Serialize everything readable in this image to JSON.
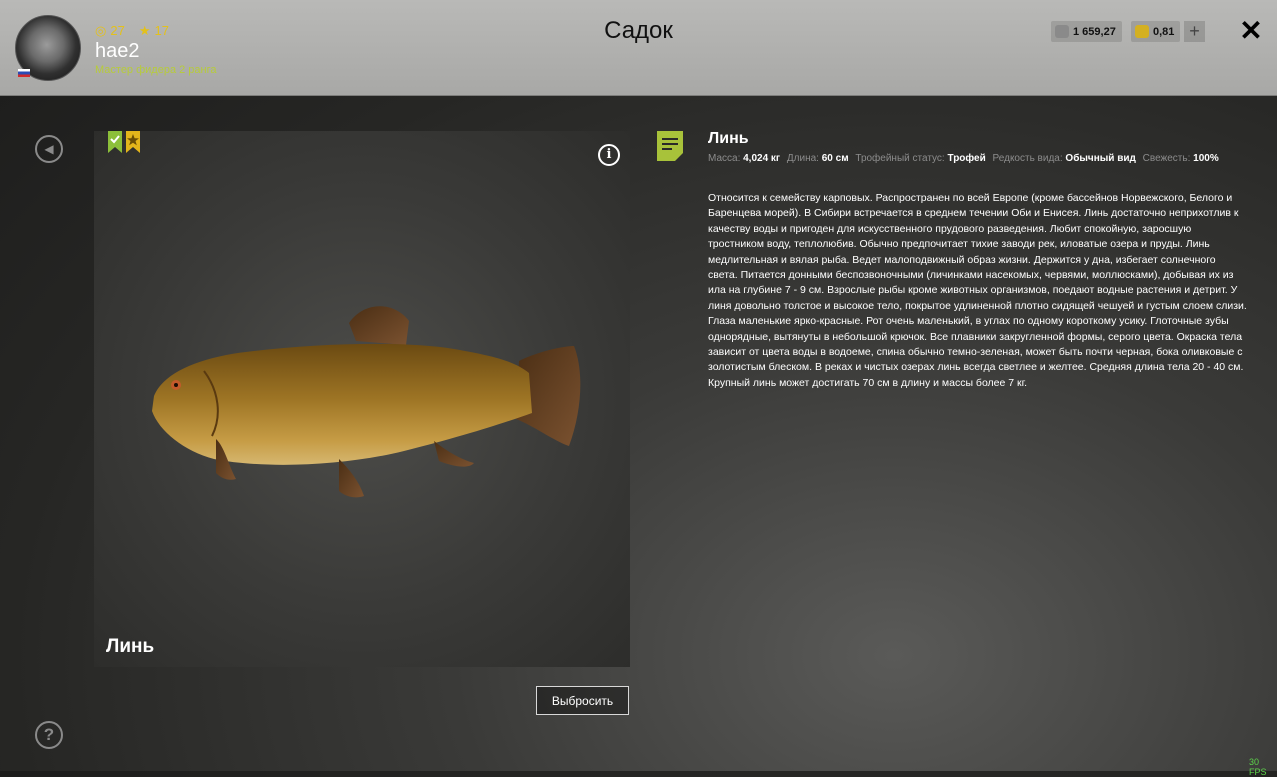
{
  "header": {
    "title": "Садок",
    "coins_count": "27",
    "stars_count": "17",
    "username": "hae2",
    "rank": "Мастер фидера 2 ранга",
    "silver": "1 659,27",
    "gold": "0,81"
  },
  "card": {
    "fish_name": "Линь",
    "throw_label": "Выбросить"
  },
  "details": {
    "name": "Линь",
    "params": [
      {
        "label": "Масса:",
        "value": "4,024 кг"
      },
      {
        "label": "Длина:",
        "value": "60 см"
      },
      {
        "label": "Трофейный статус:",
        "value": "Трофей"
      },
      {
        "label": "Редкость вида:",
        "value": "Обычный вид"
      },
      {
        "label": "Свежесть:",
        "value": "100%"
      }
    ],
    "description": "Относится к семейству карповых. Распространен по всей Европе (кроме бассейнов Норвежского, Белого и Баренцева морей). В Сибири встречается в среднем течении Оби и Енисея. Линь достаточно неприхотлив к качеству воды и пригоден для искусственного прудового разведения. Любит спокойную, заросшую тростником воду, теплолюбив. Обычно предпочитает тихие заводи рек, иловатые озера и пруды. Линь медлительная и вялая рыба. Ведет малоподвижный образ жизни. Держится у дна, избегает солнечного света. Питается донными беспозвоночными (личинками насекомых, червями, моллюсками), добывая их из ила на глубине 7 - 9 см. Взрослые рыбы кроме животных организмов, поедают водные растения и детрит. У линя довольно толстое и высокое тело, покрытое удлиненной плотно сидящей чешуей и густым слоем слизи. Глаза маленькие ярко-красные. Рот очень маленький, в углах по одному короткому усику. Глоточные зубы однорядные, вытянуты в небольшой крючок. Все плавники закругленной формы, серого цвета. Окраска тела зависит от цвета воды в водоеме, спина обычно темно-зеленая, может быть почти черная, бока оливковые с золотистым блеском. В реках и чистых озерах линь всегда светлее и желтее. Средняя длина тела 20 - 40 см. Крупный линь может достигать 70 см в длину и массы более 7 кг."
  },
  "fps": "30 FPS",
  "colors": {
    "accent_green": "#a8c23a",
    "accent_gold": "#e3c11b"
  }
}
